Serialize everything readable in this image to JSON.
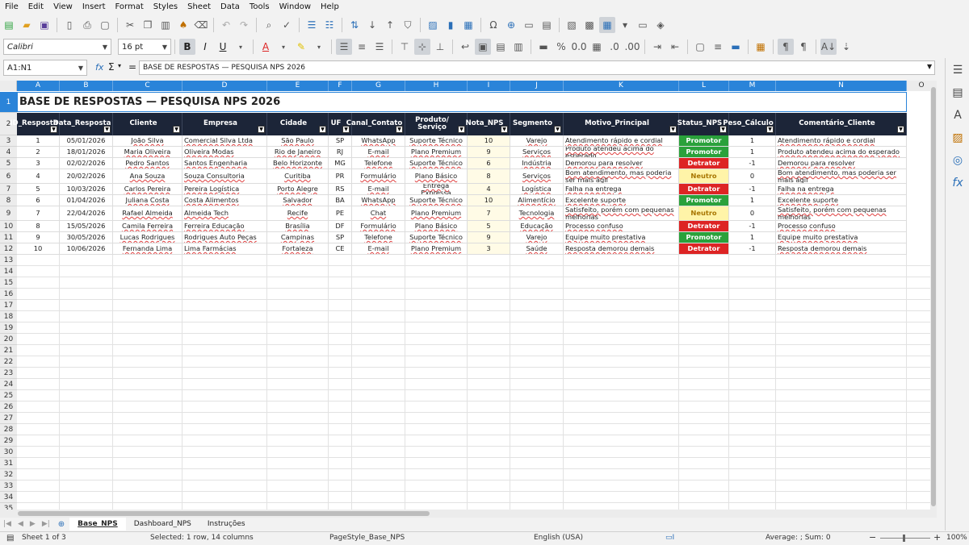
{
  "menu": [
    "File",
    "Edit",
    "View",
    "Insert",
    "Format",
    "Styles",
    "Sheet",
    "Data",
    "Tools",
    "Window",
    "Help"
  ],
  "toolbar": {
    "font_name": "Calibri",
    "font_size": "16 pt"
  },
  "formula_bar": {
    "name_box": "A1:N1",
    "fx": "fx",
    "sigma": "Σ",
    "equals": "=",
    "content": "BASE DE RESPOSTAS — PESQUISA NPS 2026"
  },
  "columns": [
    "A",
    "B",
    "C",
    "D",
    "E",
    "F",
    "G",
    "H",
    "I",
    "J",
    "K",
    "L",
    "M",
    "N",
    "O"
  ],
  "title": "BASE DE RESPOSTAS — PESQUISA NPS 2026",
  "headers": [
    "ID_Resposta",
    "Data_Resposta",
    "Cliente",
    "Empresa",
    "Cidade",
    "UF",
    "Canal_Contato",
    "Produto/ Serviço",
    "Nota_NPS",
    "Segmento",
    "Motivo_Principal",
    "Status_NPS",
    "Peso_Cálculo",
    "Comentário_Cliente"
  ],
  "rows": [
    [
      "1",
      "05/01/2026",
      "João Silva",
      "Comercial Silva Ltda",
      "São Paulo",
      "SP",
      "WhatsApp",
      "Suporte Técnico",
      "10",
      "Varejo",
      "Atendimento rápido e cordial",
      "Promotor",
      "1",
      "Atendimento rápido e cordial"
    ],
    [
      "2",
      "18/01/2026",
      "Maria Oliveira",
      "Oliveira Modas",
      "Rio de Janeiro",
      "RJ",
      "E-mail",
      "Plano Premium",
      "9",
      "Serviços",
      "Produto atendeu acima do esperado",
      "Promotor",
      "1",
      "Produto atendeu acima do esperado"
    ],
    [
      "3",
      "02/02/2026",
      "Pedro Santos",
      "Santos Engenharia",
      "Belo Horizonte",
      "MG",
      "Telefone",
      "Suporte Técnico",
      "6",
      "Indústria",
      "Demorou para resolver",
      "Detrator",
      "-1",
      "Demorou para resolver"
    ],
    [
      "4",
      "20/02/2026",
      "Ana Souza",
      "Souza Consultoria",
      "Curitiba",
      "PR",
      "Formulário",
      "Plano Básico",
      "8",
      "Serviços",
      "Bom atendimento, mas poderia ser mais ágil",
      "Neutro",
      "0",
      "Bom atendimento, mas poderia ser mais ágil"
    ],
    [
      "5",
      "10/03/2026",
      "Carlos Pereira",
      "Pereira Logística",
      "Porto Alegre",
      "RS",
      "E-mail",
      "Entrega Expressa",
      "4",
      "Logística",
      "Falha na entrega",
      "Detrator",
      "-1",
      "Falha na entrega"
    ],
    [
      "6",
      "01/04/2026",
      "Juliana Costa",
      "Costa Alimentos",
      "Salvador",
      "BA",
      "WhatsApp",
      "Suporte Técnico",
      "10",
      "Alimentício",
      "Excelente suporte",
      "Promotor",
      "1",
      "Excelente suporte"
    ],
    [
      "7",
      "22/04/2026",
      "Rafael Almeida",
      "Almeida Tech",
      "Recife",
      "PE",
      "Chat",
      "Plano Premium",
      "7",
      "Tecnologia",
      "Satisfeito, porém com pequenas melhorias",
      "Neutro",
      "0",
      "Satisfeito, porém com pequenas melhorias"
    ],
    [
      "8",
      "15/05/2026",
      "Camila Ferreira",
      "Ferreira Educação",
      "Brasília",
      "DF",
      "Formulário",
      "Plano Básico",
      "5",
      "Educação",
      "Processo confuso",
      "Detrator",
      "-1",
      "Processo confuso"
    ],
    [
      "9",
      "30/05/2026",
      "Lucas Rodrigues",
      "Rodrigues Auto Peças",
      "Campinas",
      "SP",
      "Telefone",
      "Suporte Técnico",
      "9",
      "Varejo",
      "Equipe muito prestativa",
      "Promotor",
      "1",
      "Equipe muito prestativa"
    ],
    [
      "10",
      "10/06/2026",
      "Fernanda Lima",
      "Lima Farmácias",
      "Fortaleza",
      "CE",
      "E-mail",
      "Plano Premium",
      "3",
      "Saúde",
      "Resposta demorou demais",
      "Detrator",
      "-1",
      "Resposta demorou demais"
    ]
  ],
  "row_numbers": [
    "1",
    "2",
    "3",
    "4",
    "5",
    "6",
    "7",
    "8",
    "9",
    "10",
    "11",
    "12",
    "13",
    "14",
    "15",
    "16",
    "17",
    "18",
    "19",
    "20",
    "21",
    "22",
    "23",
    "24",
    "25",
    "26",
    "27",
    "28",
    "29",
    "30",
    "31",
    "32",
    "33",
    "34",
    "35"
  ],
  "tabs": [
    "Base_NPS",
    "Dashboard_NPS",
    "Instruções"
  ],
  "active_tab": "Base_NPS",
  "status": {
    "sheet": "Sheet 1 of 3",
    "selection": "Selected: 1 row, 14 columns",
    "page_style": "PageStyle_Base_NPS",
    "language": "English (USA)",
    "sum": "Average: ; Sum: 0",
    "zoom": "100%"
  },
  "colors": {
    "header_bg": "#1c2538",
    "promotor": "#2aa13b",
    "detrator": "#dd2424",
    "neutro": "#fff4a8",
    "selection": "#2a84d9"
  }
}
